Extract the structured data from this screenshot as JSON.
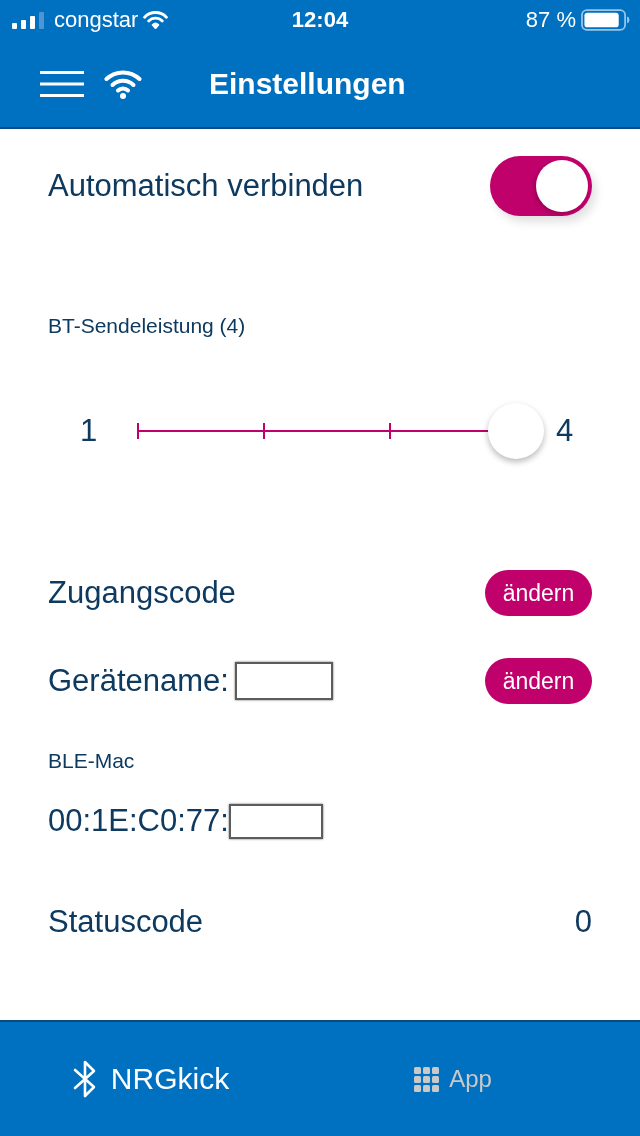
{
  "status_bar": {
    "carrier": "congstar",
    "time": "12:04",
    "battery": "87 %"
  },
  "header": {
    "title": "Einstellungen"
  },
  "auto_connect": {
    "label": "Automatisch verbinden",
    "on": true
  },
  "bt_power": {
    "label": "BT-Sendeleistung (4)",
    "min_label": "1",
    "max_label": "4",
    "level": 1
  },
  "access_code": {
    "label": "Zugangscode",
    "button": "ändern"
  },
  "device_name": {
    "label": "Gerätename:",
    "redacted": true,
    "button": "ändern"
  },
  "ble_mac": {
    "label": "BLE-Mac",
    "value": "00:1E:C0:77:",
    "redacted": true
  },
  "status_code": {
    "label": "Statuscode",
    "value": "0"
  },
  "tab_bar": {
    "tabs": [
      {
        "label": "NRGkick",
        "selected": true
      },
      {
        "label": "App",
        "selected": false
      }
    ]
  }
}
